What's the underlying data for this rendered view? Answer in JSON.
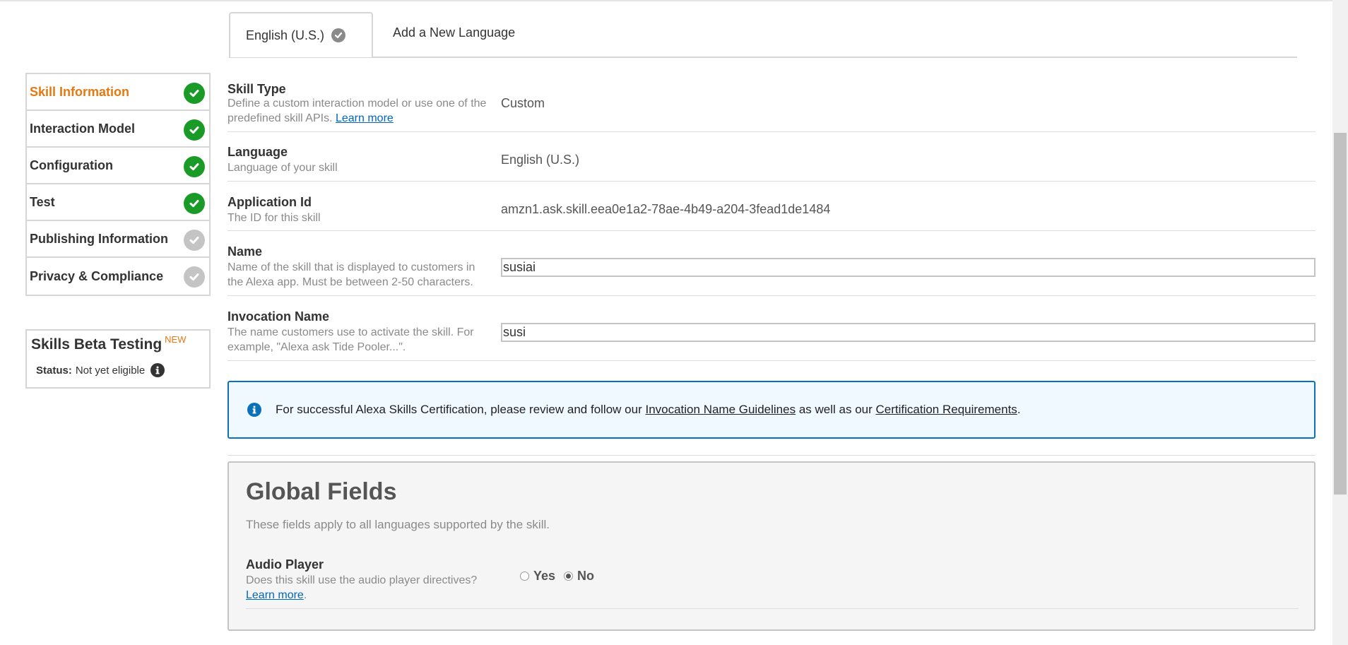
{
  "tabs": {
    "active_label": "English (U.S.)",
    "new_label": "Add a New Language"
  },
  "sidebar": {
    "items": [
      {
        "label": "Skill Information",
        "status": "complete",
        "active": true
      },
      {
        "label": "Interaction Model",
        "status": "complete",
        "active": false
      },
      {
        "label": "Configuration",
        "status": "complete",
        "active": false
      },
      {
        "label": "Test",
        "status": "complete",
        "active": false
      },
      {
        "label": "Publishing Information",
        "status": "incomplete",
        "active": false
      },
      {
        "label": "Privacy & Compliance",
        "status": "incomplete",
        "active": false
      }
    ]
  },
  "beta": {
    "title": "Skills Beta Testing",
    "badge": "NEW",
    "status_label": "Status:",
    "status_value": "Not yet eligible"
  },
  "form": {
    "skill_type": {
      "title": "Skill Type",
      "desc": "Define a custom interaction model or use one of the predefined skill APIs.",
      "link": "Learn more",
      "value": "Custom"
    },
    "language": {
      "title": "Language",
      "desc": "Language of your skill",
      "value": "English (U.S.)"
    },
    "app_id": {
      "title": "Application Id",
      "desc": "The ID for this skill",
      "value": "amzn1.ask.skill.eea0e1a2-78ae-4b49-a204-3fead1de1484"
    },
    "name": {
      "title": "Name",
      "desc": "Name of the skill that is displayed to customers in the Alexa app. Must be between 2-50 characters.",
      "value": "susiai"
    },
    "invocation": {
      "title": "Invocation Name",
      "desc": "The name customers use to activate the skill. For example, \"Alexa ask Tide Pooler...\".",
      "value": "susi"
    }
  },
  "banner": {
    "text_before": "For successful Alexa Skills Certification, please review and follow our",
    "link1": "Invocation Name Guidelines",
    "text_middle": "as well as our",
    "link2": "Certification Requirements",
    "text_after": "."
  },
  "global": {
    "title": "Global Fields",
    "desc": "These fields apply to all languages supported by the skill.",
    "audio_player": {
      "title": "Audio Player",
      "desc": "Does this skill use the audio player directives?",
      "link": "Learn more",
      "link_suffix": ".",
      "yes_label": "Yes",
      "no_label": "No",
      "selected": "No"
    }
  },
  "colors": {
    "accent_orange": "#e47911",
    "complete_green": "#1a9b27",
    "incomplete_gray": "#c4c4c4",
    "link_blue": "#0066c0",
    "banner_border": "#0b72b9"
  },
  "icons": {
    "tab_status": "check-circle-icon",
    "step_complete": "check-circle-icon",
    "step_incomplete": "check-circle-icon",
    "beta_info": "info-icon",
    "banner_info": "info-icon"
  }
}
